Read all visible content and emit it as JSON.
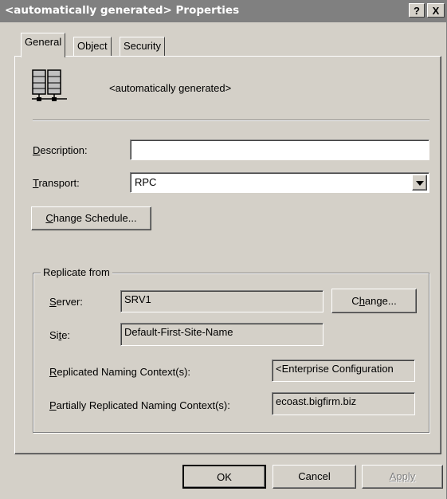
{
  "window": {
    "title": "<automatically generated> Properties",
    "help_label": "?",
    "close_label": "X"
  },
  "tabs": [
    {
      "label": "General",
      "active": true
    },
    {
      "label": "Object",
      "active": false
    },
    {
      "label": "Security",
      "active": false
    }
  ],
  "general": {
    "object_name": "<automatically generated>",
    "description_label": "Description:",
    "description_accel": "D",
    "description_rest": "escription:",
    "description_value": "",
    "transport_label": "Transport:",
    "transport_accel": "T",
    "transport_rest": "ransport:",
    "transport_value": "RPC",
    "change_schedule_accel": "C",
    "change_schedule_rest": "hange Schedule..."
  },
  "replicate_from": {
    "legend": "Replicate from",
    "server_accel": "S",
    "server_rest": "erver:",
    "server_value": "SRV1",
    "change_pre": "C",
    "change_accel": "h",
    "change_rest": "ange...",
    "site_pre": "Si",
    "site_accel": "t",
    "site_rest": "e:",
    "site_value": "Default-First-Site-Name",
    "rnc_accel": "R",
    "rnc_rest": "eplicated Naming Context(s):",
    "rnc_value": "<Enterprise Configuration",
    "prnc_accel": "P",
    "prnc_rest": "artially Replicated Naming Context(s):",
    "prnc_value": "ecoast.bigfirm.biz"
  },
  "footer": {
    "ok_label": "OK",
    "cancel_label": "Cancel",
    "apply_label": "Apply"
  },
  "icons": {
    "object": "connection-object-icon",
    "dropdown": "chevron-down-icon"
  }
}
